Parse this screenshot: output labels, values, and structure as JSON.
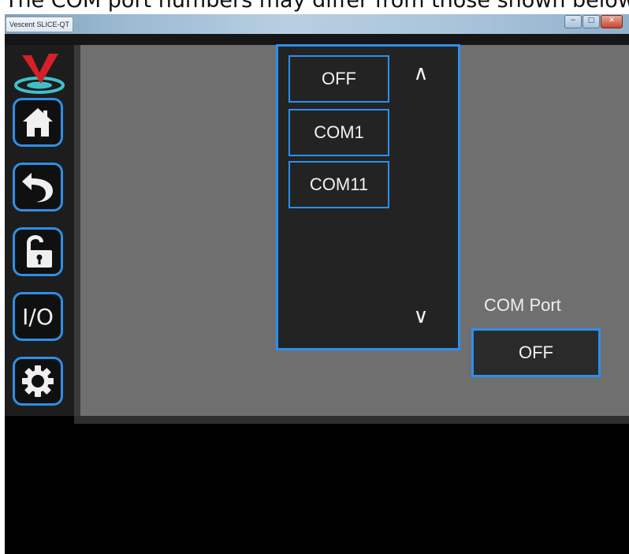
{
  "caption": "The COM port numbers may differ from those shown below.",
  "window": {
    "title": "Vescent SLICE-QT",
    "controls": {
      "minimize": "−",
      "maximize": "□",
      "close": "✕"
    }
  },
  "sidebar": {
    "logo": "vescent-logo",
    "items": [
      {
        "name": "home",
        "icon": "home-icon"
      },
      {
        "name": "back",
        "icon": "back-arrow-icon"
      },
      {
        "name": "lock",
        "icon": "unlock-icon"
      },
      {
        "name": "io",
        "label": "I/O"
      },
      {
        "name": "settings",
        "icon": "gear-icon"
      }
    ]
  },
  "dropdown": {
    "options": [
      "OFF",
      "COM1",
      "COM11"
    ],
    "scroll_up": "∧",
    "scroll_down": "∨"
  },
  "com_port": {
    "label": "COM Port",
    "value": "OFF"
  },
  "colors": {
    "accent": "#2b8ff0",
    "main_bg": "#6f6f6f",
    "panel_bg": "#232323",
    "logo_red": "#d42027",
    "logo_teal": "#3fc1c9"
  }
}
